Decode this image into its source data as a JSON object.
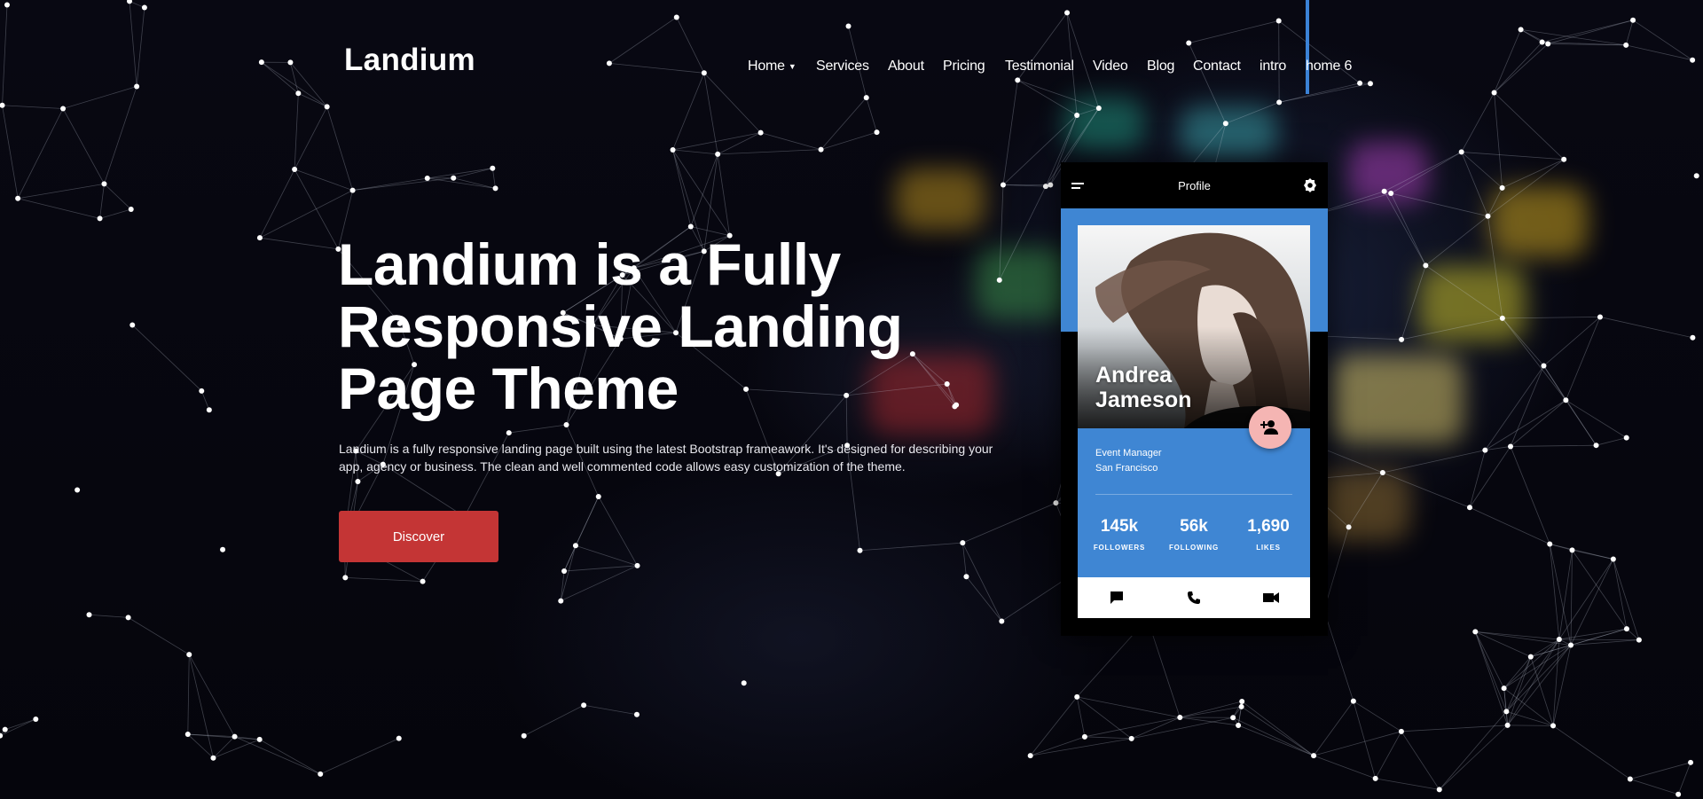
{
  "header": {
    "logo": "Landium",
    "nav": [
      {
        "label": "Home",
        "caret": true
      },
      {
        "label": "Services"
      },
      {
        "label": "About"
      },
      {
        "label": "Pricing"
      },
      {
        "label": "Testimonial"
      },
      {
        "label": "Video"
      },
      {
        "label": "Blog"
      },
      {
        "label": "Contact"
      },
      {
        "label": "intro"
      },
      {
        "label": "home 6",
        "active": true
      }
    ]
  },
  "hero": {
    "title_lines": [
      "Landium is a Fully",
      "Responsive Landing",
      "Page Theme"
    ],
    "description": "Landium is a fully responsive landing page built using the latest Bootstrap frameawork. It's designed for describing your app, agency or business. The clean and well commented code allows easy customization of the theme.",
    "button_label": "Discover"
  },
  "phone": {
    "header_title": "Profile",
    "name_lines": [
      "Andrea",
      "Jameson"
    ],
    "role": "Event Manager",
    "location": "San Francisco",
    "stats": [
      {
        "value": "145k",
        "label": "FOLLOWERS"
      },
      {
        "value": "56k",
        "label": "FOLLOWING"
      },
      {
        "value": "1,690",
        "label": "LIKES"
      }
    ],
    "actions": [
      "chat-icon",
      "phone-icon",
      "video-camera-icon"
    ]
  },
  "colors": {
    "accent_blue": "#3f86d3",
    "button_red": "#c43535",
    "fab_pink": "#f5b5b3",
    "nav_active_bar": "#3b82d6"
  }
}
